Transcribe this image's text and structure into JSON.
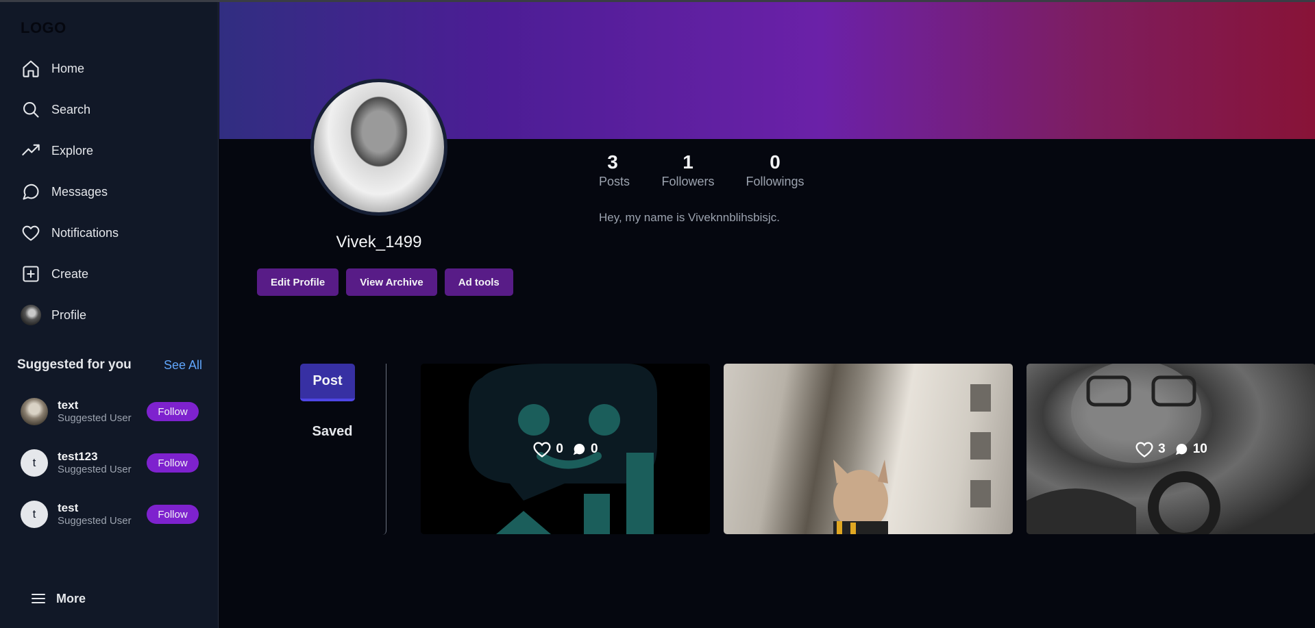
{
  "app": {
    "logo": "LOGO"
  },
  "sidebar": {
    "nav": [
      {
        "label": "Home",
        "icon": "home-icon"
      },
      {
        "label": "Search",
        "icon": "search-icon"
      },
      {
        "label": "Explore",
        "icon": "trending-up-icon"
      },
      {
        "label": "Messages",
        "icon": "message-circle-icon"
      },
      {
        "label": "Notifications",
        "icon": "heart-icon"
      },
      {
        "label": "Create",
        "icon": "plus-square-icon"
      },
      {
        "label": "Profile",
        "icon": "avatar-icon"
      }
    ],
    "suggested": {
      "title": "Suggested for you",
      "see_all": "See All",
      "users": [
        {
          "name": "text",
          "subtitle": "Suggested User",
          "avatar": "",
          "follow": "Follow"
        },
        {
          "name": "test123",
          "subtitle": "Suggested User",
          "avatar": "t",
          "follow": "Follow"
        },
        {
          "name": "test",
          "subtitle": "Suggested User",
          "avatar": "t",
          "follow": "Follow"
        }
      ]
    },
    "more_label": "More"
  },
  "profile": {
    "username": "Vivek_1499",
    "buttons": {
      "edit": "Edit Profile",
      "archive": "View Archive",
      "ad_tools": "Ad tools"
    },
    "stats": [
      {
        "value": "3",
        "label": "Posts"
      },
      {
        "value": "1",
        "label": "Followers"
      },
      {
        "value": "0",
        "label": "Followings"
      }
    ],
    "bio": "Hey, my name is Viveknnblihsbisjc."
  },
  "tabs": {
    "post": "Post",
    "saved": "Saved"
  },
  "posts": [
    {
      "likes": "0",
      "comments": "0"
    },
    {
      "likes": "",
      "comments": ""
    },
    {
      "likes": "3",
      "comments": "10"
    }
  ],
  "colors": {
    "sidebar_bg": "#111827",
    "page_bg": "#05070f",
    "accent_purple": "#7e22ce",
    "button_purple": "#581c87",
    "tab_active": "#3730a3",
    "link_blue": "#60a5fa"
  }
}
